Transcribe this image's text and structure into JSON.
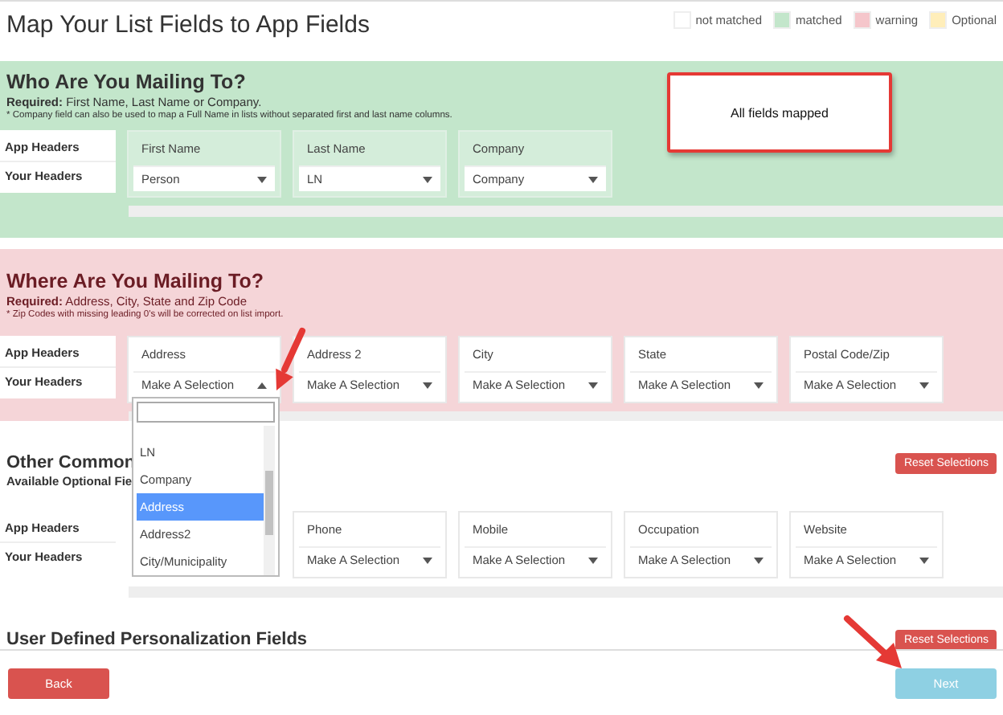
{
  "page_title": "Map Your List Fields to App Fields",
  "legend": [
    {
      "label": "not matched",
      "color": "#ffffff"
    },
    {
      "label": "matched",
      "color": "#c3e6cb"
    },
    {
      "label": "warning",
      "color": "#f5c6cb"
    },
    {
      "label": "Optional",
      "color": "#ffeeba"
    }
  ],
  "sections": [
    {
      "kind": "matched",
      "title": "Who Are You Mailing To?",
      "required_label": "Required:",
      "required_text": "First Name, Last Name or Company.",
      "note": "* Company field can also be used to map a Full Name in lists without separated first and last name columns.",
      "row_labels": [
        "App Headers",
        "Your Headers"
      ],
      "fields": [
        {
          "label": "First Name",
          "value": "Person",
          "open": false
        },
        {
          "label": "Last Name",
          "value": "LN",
          "open": false
        },
        {
          "label": "Company",
          "value": "Company",
          "open": false
        }
      ],
      "message": "All fields mapped"
    },
    {
      "kind": "warning",
      "title": "Where Are You Mailing To?",
      "required_label": "Required:",
      "required_text": "Address, City, State and Zip Code",
      "note": "* Zip Codes with missing leading 0's will be corrected on list import.",
      "row_labels": [
        "App Headers",
        "Your Headers"
      ],
      "fields": [
        {
          "label": "Address",
          "value": "Make A Selection",
          "open": true
        },
        {
          "label": "Address 2",
          "value": "Make A Selection",
          "open": false
        },
        {
          "label": "City",
          "value": "Make A Selection",
          "open": false
        },
        {
          "label": "State",
          "value": "Make A Selection",
          "open": false
        },
        {
          "label": "Postal Code/Zip",
          "value": "Make A Selection",
          "open": false
        }
      ]
    },
    {
      "kind": "not_matched",
      "title": "Other Common",
      "subtitle": "Available Optional Fie",
      "reset": "Reset Selections",
      "row_labels": [
        "App Headers",
        "Your Headers"
      ],
      "fields": [
        {
          "label": "Phone",
          "value": "Make A Selection",
          "open": false
        },
        {
          "label": "Mobile",
          "value": "Make A Selection",
          "open": false
        },
        {
          "label": "Occupation",
          "value": "Make A Selection",
          "open": false
        },
        {
          "label": "Website",
          "value": "Make A Selection",
          "open": false
        }
      ]
    },
    {
      "kind": "not_matched",
      "title": "User Defined Personalization Fields",
      "reset": "Reset Selections"
    }
  ],
  "dropdown": {
    "options": [
      {
        "label": "LN",
        "selected": false
      },
      {
        "label": "Company",
        "selected": false
      },
      {
        "label": "Address",
        "selected": true
      },
      {
        "label": "Address2",
        "selected": false
      },
      {
        "label": "City/Municipality",
        "selected": false
      }
    ]
  },
  "footer": {
    "back": "Back",
    "next": "Next"
  }
}
